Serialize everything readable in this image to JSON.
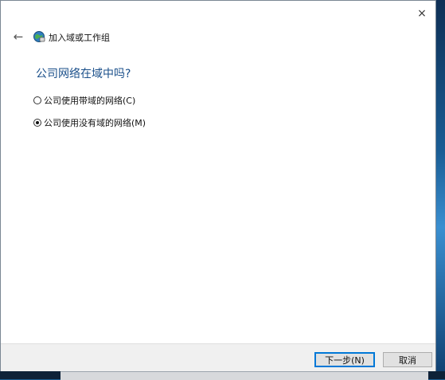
{
  "dialog": {
    "close_glyph": "×",
    "back_glyph": "←",
    "title": "加入域或工作组",
    "question": "公司网络在域中吗?",
    "options": [
      {
        "label": "公司使用带域的网络(C)",
        "checked": false
      },
      {
        "label": "公司使用没有域的网络(M)",
        "checked": true
      }
    ],
    "buttons": {
      "next": "下一步(N)",
      "cancel": "取消"
    }
  },
  "icons": {
    "wizard": "network-globe-icon",
    "close": "close-icon",
    "back": "back-arrow-icon"
  },
  "colors": {
    "question": "#1a4f8a",
    "accent": "#0078d7",
    "footer": "#f0f0f0"
  }
}
